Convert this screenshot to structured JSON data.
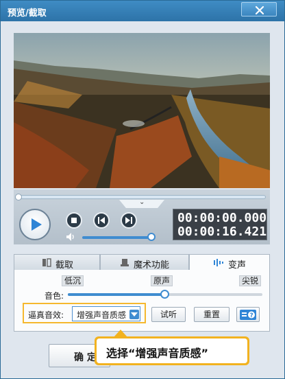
{
  "window": {
    "title": "预览/截取"
  },
  "player": {
    "current_time": "00:00:00.000",
    "total_time": "00:00:16.421",
    "progress": 0.0,
    "volume": 0.95
  },
  "tabs": [
    {
      "label": "截取",
      "icon": "film-cut-icon",
      "active": false
    },
    {
      "label": "魔术功能",
      "icon": "magic-hat-icon",
      "active": false
    },
    {
      "label": "变声",
      "icon": "sound-wave-icon",
      "active": true
    }
  ],
  "voice_change": {
    "pitch_label": "音色:",
    "pitch_low": "低沉",
    "pitch_mid": "原声",
    "pitch_high": "尖锐",
    "pitch_value": 0.5,
    "effect_label": "逼真音效:",
    "effect_selected": "增强声音质感",
    "preview_button": "试听",
    "reset_button": "重置"
  },
  "confirm_button": "确 定",
  "tooltip": {
    "text": "选择“增强声音质感”"
  },
  "colors": {
    "accent": "#3f8cd0",
    "highlight": "#f2b21f",
    "titlebar": "#2d73a8"
  }
}
